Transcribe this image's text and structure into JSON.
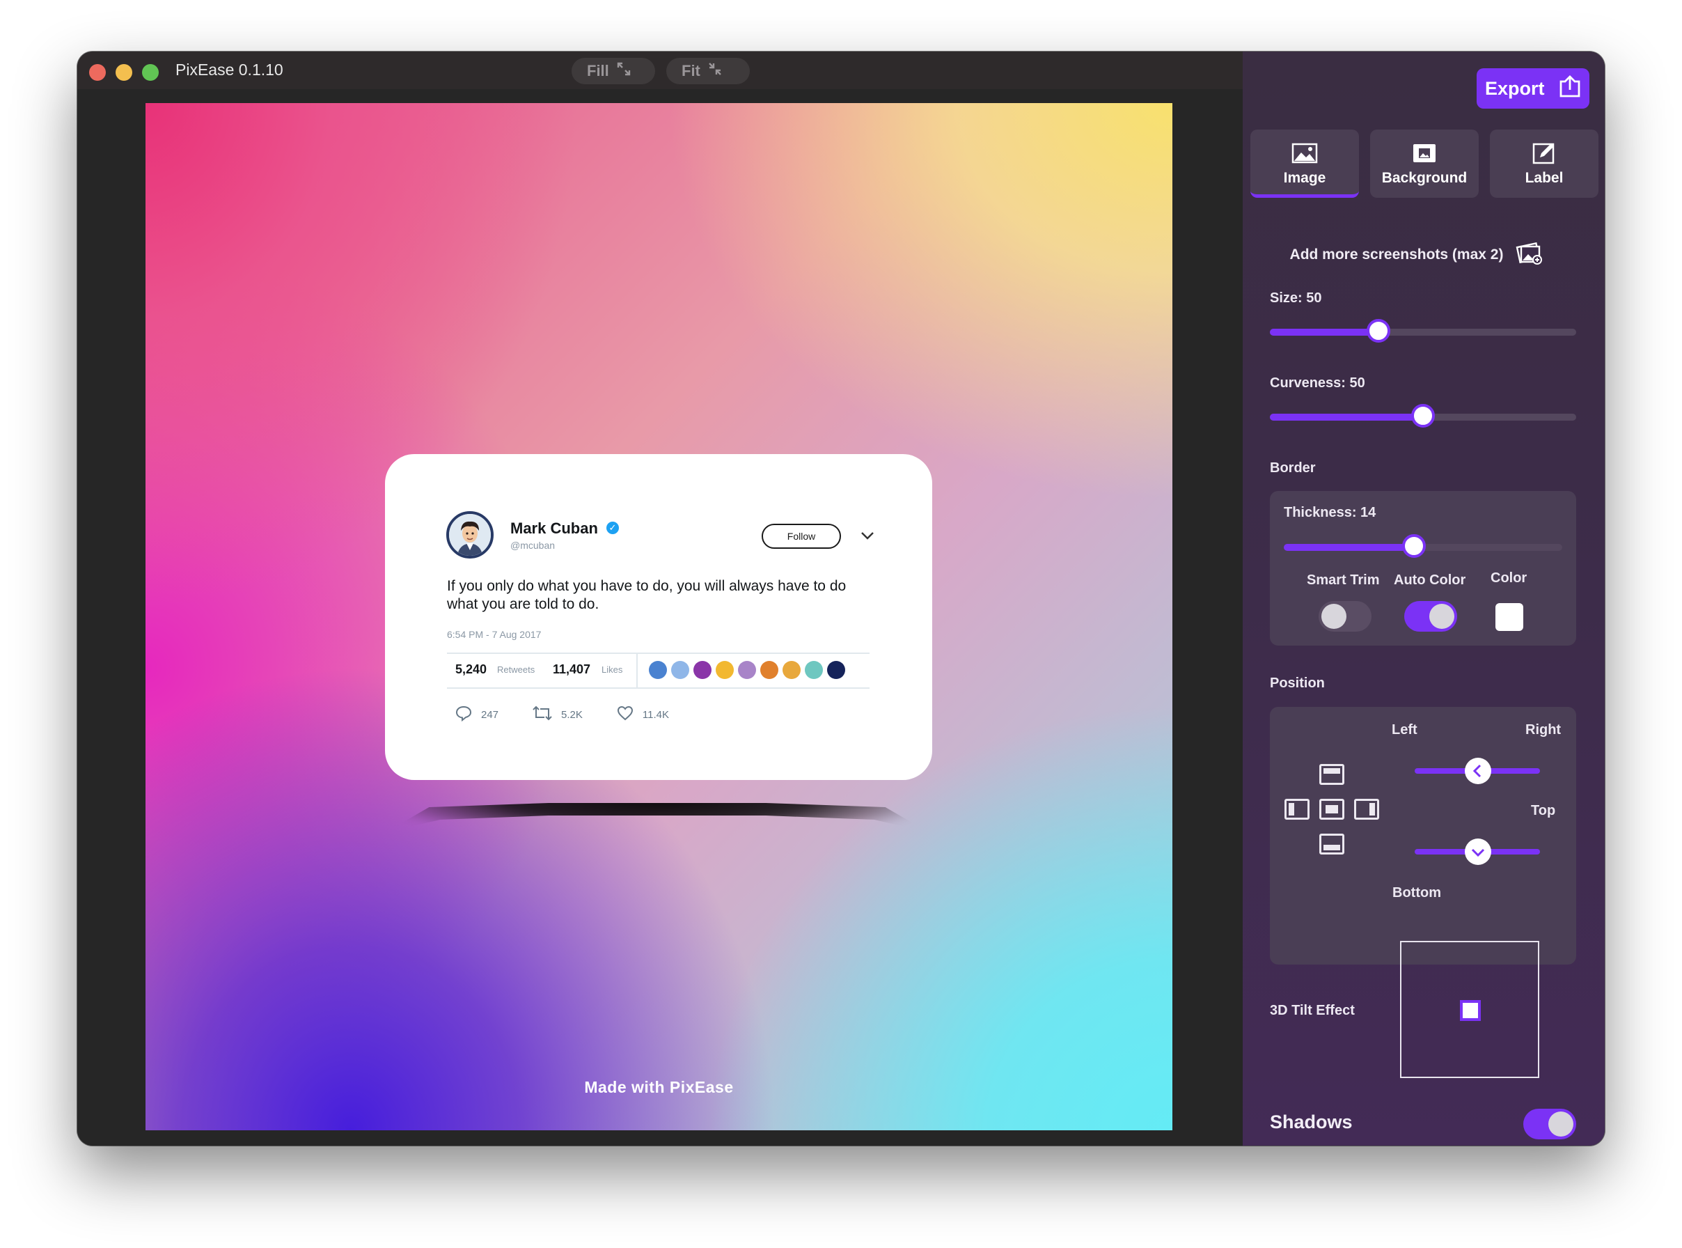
{
  "window": {
    "title": "PixEase 0.1.10",
    "fill_label": "Fill",
    "fit_label": "Fit"
  },
  "tweet": {
    "name": "Mark Cuban",
    "handle": "@mcuban",
    "follow_label": "Follow",
    "text": "If you only do what you have to do, you will always have to do what you are told to do.",
    "time": "6:54 PM - 7 Aug 2017",
    "retweets_count": "5,240",
    "retweets_label": "Retweets",
    "likes_count": "11,407",
    "likes_label": "Likes",
    "reply_count": "247",
    "retweet_action_count": "5.2K",
    "like_action_count": "11.4K",
    "liker_colors": [
      "#4a82d0",
      "#8fb6e8",
      "#8a35a8",
      "#f2b830",
      "#a884c8",
      "#e0802c",
      "#e8a83c",
      "#6ec7c0",
      "#15235a"
    ]
  },
  "watermark": "Made with PixEase",
  "sidebar": {
    "export_label": "Export",
    "tabs": [
      {
        "label": "Image",
        "active": true
      },
      {
        "label": "Background",
        "active": false
      },
      {
        "label": "Label",
        "active": false
      }
    ],
    "add_more_label": "Add more screenshots (max 2)",
    "size_label": "Size: 50",
    "size_value": 50,
    "curveness_label": "Curveness: 50",
    "curveness_value": 50,
    "border_label": "Border",
    "thickness_label": "Thickness: 14",
    "thickness_value": 14,
    "smart_trim_label": "Smart Trim",
    "smart_trim_on": false,
    "auto_color_label": "Auto Color",
    "auto_color_on": true,
    "color_label": "Color",
    "border_color": "#ffffff",
    "position_label": "Position",
    "left_label": "Left",
    "right_label": "Right",
    "top_label": "Top",
    "bottom_label": "Bottom",
    "tilt_label": "3D Tilt Effect",
    "shadows_label": "Shadows",
    "shadows_on": true
  },
  "colors": {
    "accent": "#7b32f5",
    "sidebar_bg": "#3d2c4a",
    "panel_bg": "#4a3e55"
  }
}
